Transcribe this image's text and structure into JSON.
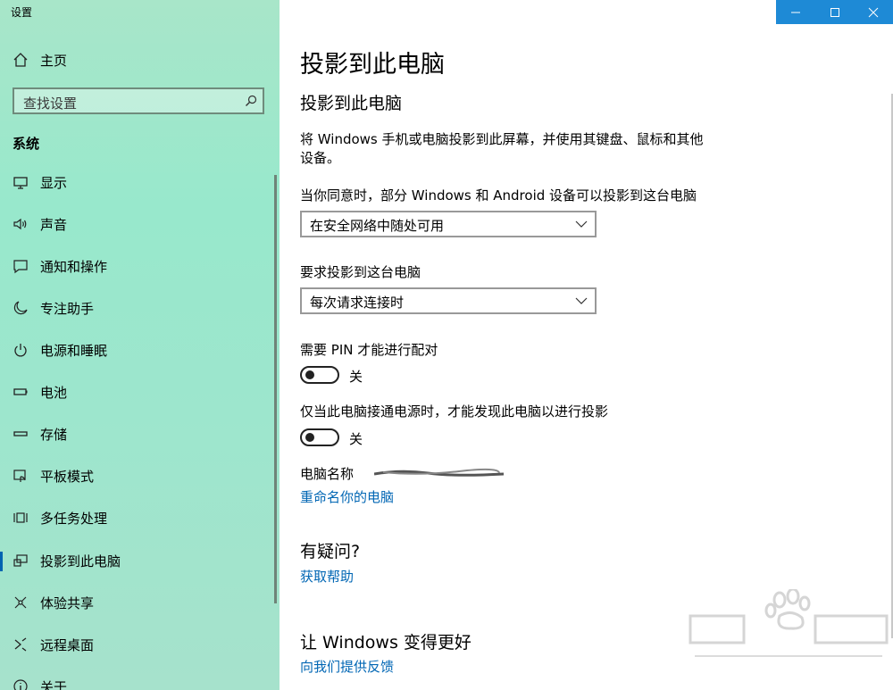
{
  "app": {
    "title": "设置"
  },
  "sidebar": {
    "home_label": "主页",
    "search_placeholder": "查找设置",
    "group_title": "系统",
    "items": [
      {
        "label": "显示",
        "icon": "monitor-icon"
      },
      {
        "label": "声音",
        "icon": "speaker-icon"
      },
      {
        "label": "通知和操作",
        "icon": "notification-icon"
      },
      {
        "label": "专注助手",
        "icon": "moon-icon"
      },
      {
        "label": "电源和睡眠",
        "icon": "power-icon"
      },
      {
        "label": "电池",
        "icon": "battery-icon"
      },
      {
        "label": "存储",
        "icon": "storage-icon"
      },
      {
        "label": "平板模式",
        "icon": "tablet-icon"
      },
      {
        "label": "多任务处理",
        "icon": "multitask-icon"
      },
      {
        "label": "投影到此电脑",
        "icon": "project-icon",
        "selected": true
      },
      {
        "label": "体验共享",
        "icon": "share-icon"
      },
      {
        "label": "远程桌面",
        "icon": "remote-icon"
      },
      {
        "label": "关于",
        "icon": "info-icon"
      }
    ]
  },
  "window": {
    "controls": [
      "minimize-icon",
      "maximize-icon",
      "close-icon"
    ]
  },
  "main": {
    "page_title": "投影到此电脑",
    "section_title": "投影到此电脑",
    "description_line1": "将 Windows 手机或电脑投影到此屏幕，并使用其键盘、鼠标和其他",
    "description_line2": "设备。",
    "availability_label": "当你同意时，部分 Windows 和 Android 设备可以投影到这台电脑",
    "availability_value": "在安全网络中随处可用",
    "ask_label": "要求投影到这台电脑",
    "ask_value": "每次请求连接时",
    "pin_label": "需要 PIN 才能进行配对",
    "pin_state": "关",
    "power_label": "仅当此电脑接通电源时，才能发现此电脑以进行投影",
    "power_state": "关",
    "pc_name_label": "电脑名称",
    "rename_link": "重命名你的电脑",
    "question_title": "有疑问?",
    "help_link": "获取帮助",
    "improve_title": "让 Windows 变得更好",
    "feedback_link": "向我们提供反馈"
  },
  "colors": {
    "accent": "#0063b1",
    "link": "#0066b4",
    "titlebar": "#1e8ad6"
  }
}
